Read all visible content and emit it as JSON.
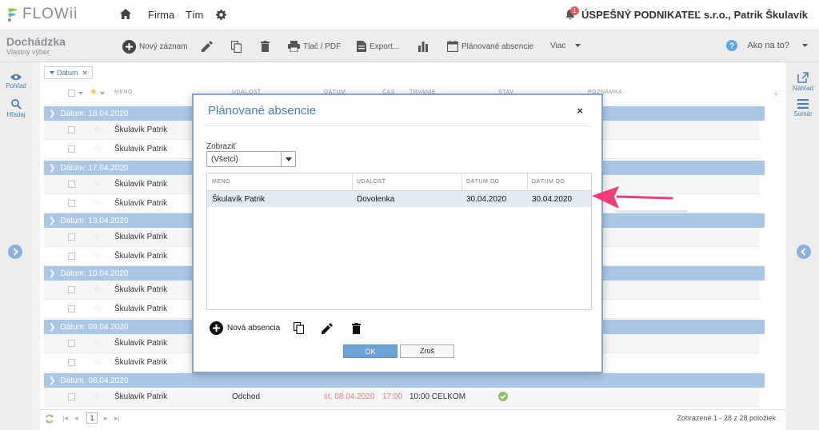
{
  "app": {
    "logo": "FLOWii",
    "nav": [
      "Firma",
      "Tím"
    ],
    "company": "ÚSPEŠNÝ PODNIKATEĽ s.r.o., Patrik Škulavík",
    "notification_count": "1"
  },
  "toolbar": {
    "title": "Dochádzka",
    "subtitle": "Vlastný výber",
    "new_record": "Nový záznam",
    "print": "Tlač / PDF",
    "export": "Export...",
    "planned_absences": "Plánované absencie",
    "more": "Viac",
    "help": "Ako na to?"
  },
  "left_side": {
    "view": "Pohľad",
    "search": "Hľadaj"
  },
  "right_side": {
    "preview": "Náhľad",
    "summary": "Sumár"
  },
  "grid": {
    "filter_chip": "Dátum",
    "columns": {
      "name": "MENO",
      "event": "UDALOSŤ",
      "date": "DÁTUM",
      "time": "ČAS",
      "duration": "TRVANIE",
      "status": "STAV",
      "note": "POZNÁMKA"
    },
    "groups": [
      {
        "label": "Dátum: 18.04.2020",
        "rows": [
          "Škulavík Patrik",
          "Škulavík Patrik"
        ]
      },
      {
        "label": "Dátum: 17.04.2020",
        "rows": [
          "Škulavík Patrik",
          "Škulavík Patrik"
        ]
      },
      {
        "label": "Dátum: 13.04.2020",
        "rows": [
          "Škulavík Patrik",
          "Škulavík Patrik"
        ]
      },
      {
        "label": "Dátum: 10.04.2020",
        "rows": [
          "Škulavík Patrik",
          "Škulavík Patrik"
        ]
      },
      {
        "label": "Dátum: 09.04.2020",
        "rows": [
          "Škulavík Patrik",
          "Škulavík Patrik"
        ]
      },
      {
        "label": "Dátum: 08.04.2020",
        "rows": [
          "Škulavík Patrik"
        ]
      }
    ],
    "last_row": {
      "name": "Škulavík Patrik",
      "event": "Odchod",
      "date": "st, 08.04.2020",
      "time": "17:00",
      "duration": "10:00 CELKOM"
    }
  },
  "pager": {
    "page": "1",
    "summary": "Zobrazené 1 - 28 z 28 položiek"
  },
  "modal": {
    "title": "Plánované absencie",
    "close": "×",
    "show_label": "Zobraziť",
    "show_value": "(Všetci)",
    "columns": {
      "name": "MENO",
      "event": "UDALOSŤ",
      "date_from": "DÁTUM OD",
      "date_to": "DÁTUM DO"
    },
    "rows": [
      {
        "name": "Škulavík Patrik",
        "event": "Dovolenka",
        "date_from": "30.04.2020",
        "date_to": "30.04.2020"
      }
    ],
    "new_absence": "Nová absencia",
    "ok": "OK",
    "cancel": "Zruš"
  },
  "colors": {
    "accent": "#4a7fb3",
    "group": "#aac8e6",
    "arrow": "#f03c78"
  }
}
